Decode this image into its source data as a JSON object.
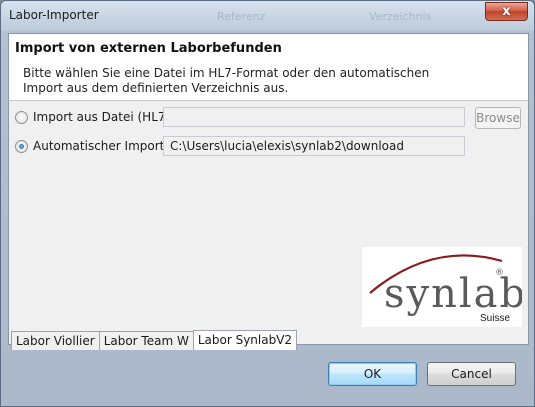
{
  "window": {
    "title": "Labor-Importer",
    "background_ghost_1": "Referenz",
    "background_ghost_2": "Verzeichnis",
    "close_label": "x"
  },
  "header": {
    "title": "Import von externen Laborbefunden",
    "description": "Bitte wählen Sie eine Datei im HL7-Format oder den automatischen Import aus dem definierten Verzeichnis aus."
  },
  "options": {
    "file_import": {
      "label": "Import aus Datei (HL7)",
      "value": "",
      "checked": false
    },
    "browse_label": "Browse",
    "auto_import": {
      "label": "Automatischer Import",
      "value": "C:\\Users\\lucia\\elexis\\synlab2\\download",
      "checked": true
    }
  },
  "logo": {
    "brand_text": "synlab",
    "registered_mark": "®",
    "subtitle": "Suisse",
    "brand_color": "#8b1a1a",
    "text_color": "#5a5a5a"
  },
  "tabs": [
    {
      "label": "Labor Viollier",
      "active": false
    },
    {
      "label": "Labor Team W",
      "active": false
    },
    {
      "label": "Labor SynlabV2",
      "active": true
    }
  ],
  "buttons": {
    "ok": "OK",
    "cancel": "Cancel"
  }
}
